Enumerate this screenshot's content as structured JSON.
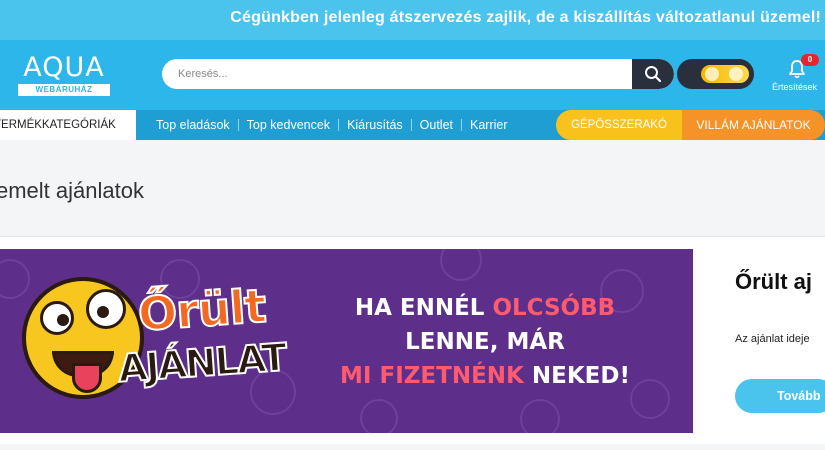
{
  "announcement": "Cégünkben jelenleg átszervezés zajlik, de a kiszállítás változatlanul üzemel!",
  "header": {
    "logo_text": "AQUA",
    "logo_sub": "WEBÁRUHÁZ",
    "search_placeholder": "Keresés...",
    "notifications_count": "0",
    "notifications_label": "Értesítések"
  },
  "nav": {
    "categories_label": "TERMÉKKATEGÓRIÁK",
    "links": [
      "Top eladások",
      "Top kedvencek",
      "Kiárusítás",
      "Outlet",
      "Karrier"
    ],
    "gepossze_label": "GÉPÖSSZERAKÓ",
    "villam_label": "VILLÁM AJÁNLATOK"
  },
  "page_title": "emelt ajánlatok",
  "banner": {
    "brand_line1": "Őrült",
    "brand_line2": "AJÁNLAT",
    "slogan_l1_a": "HA ENNÉL ",
    "slogan_l1_b": "OLCSÓBB",
    "slogan_l2": "LENNE, MÁR",
    "slogan_l3_a": "MI FIZETNÉNK",
    "slogan_l3_b": " NEKED!"
  },
  "offer": {
    "title": "Őrült aj",
    "text": "Az ajánlat ideje",
    "button_label": "Tovább"
  },
  "colors": {
    "header_bg": "#2db6e9",
    "announce_bg": "#4ac4ec",
    "nav_bg": "#1e9ed3",
    "banner_bg": "#5d2e8a",
    "gepossze": "#f8c11c",
    "villam": "#f59228"
  }
}
